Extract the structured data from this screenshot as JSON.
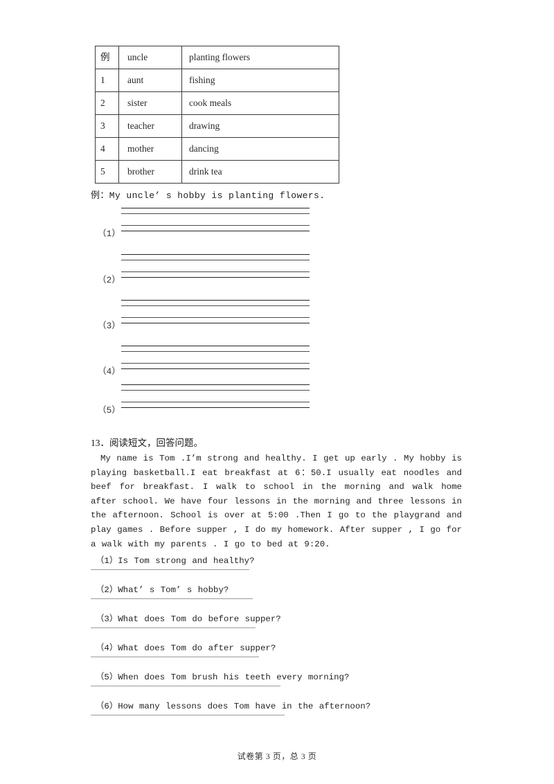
{
  "table": {
    "rows": [
      {
        "num": "例",
        "person": "uncle",
        "hobby": "planting flowers"
      },
      {
        "num": "1",
        "person": "aunt",
        "hobby": "fishing"
      },
      {
        "num": "2",
        "person": "sister",
        "hobby": "cook meals"
      },
      {
        "num": "3",
        "person": "teacher",
        "hobby": "drawing"
      },
      {
        "num": "4",
        "person": "mother",
        "hobby": "dancing"
      },
      {
        "num": "5",
        "person": "brother",
        "hobby": "drink tea"
      }
    ]
  },
  "example": {
    "sentence": "例：My uncle’ s hobby is planting flowers."
  },
  "writing_groups": [
    {
      "label": "（1）"
    },
    {
      "label": "（2）"
    },
    {
      "label": "（3）"
    },
    {
      "label": "（4）"
    },
    {
      "label": "（5）"
    }
  ],
  "section13": {
    "heading": "13．阅读短文，回答问题。",
    "passage": "My name is Tom .I’m strong and healthy. I get up early . My hobby is playing basketball.I eat breakfast  at 6：50.I usually eat noodles and beef for breakfast. I walk to school in the morning and walk home after school. We have four lessons in the morning and three lessons in the afternoon. School is over at 5:00 .Then I go to the playgrand and play games . Before supper , I do my homework. After supper , I go for a walk with my parents . I go to bed at 9:20.",
    "questions": [
      {
        "text": "（1）Is Tom strong and healthy?"
      },
      {
        "text": "（2）What’ s Tom’ s hobby?"
      },
      {
        "text": "（3）What does Tom do before supper?"
      },
      {
        "text": "（4）What does Tom do after supper?"
      },
      {
        "text": "（5）When does Tom brush his teeth every morning?"
      },
      {
        "text": "（6）How many lessons does Tom have in the afternoon?"
      }
    ]
  },
  "footer": {
    "text": "试卷第 3 页，总 3 页"
  }
}
